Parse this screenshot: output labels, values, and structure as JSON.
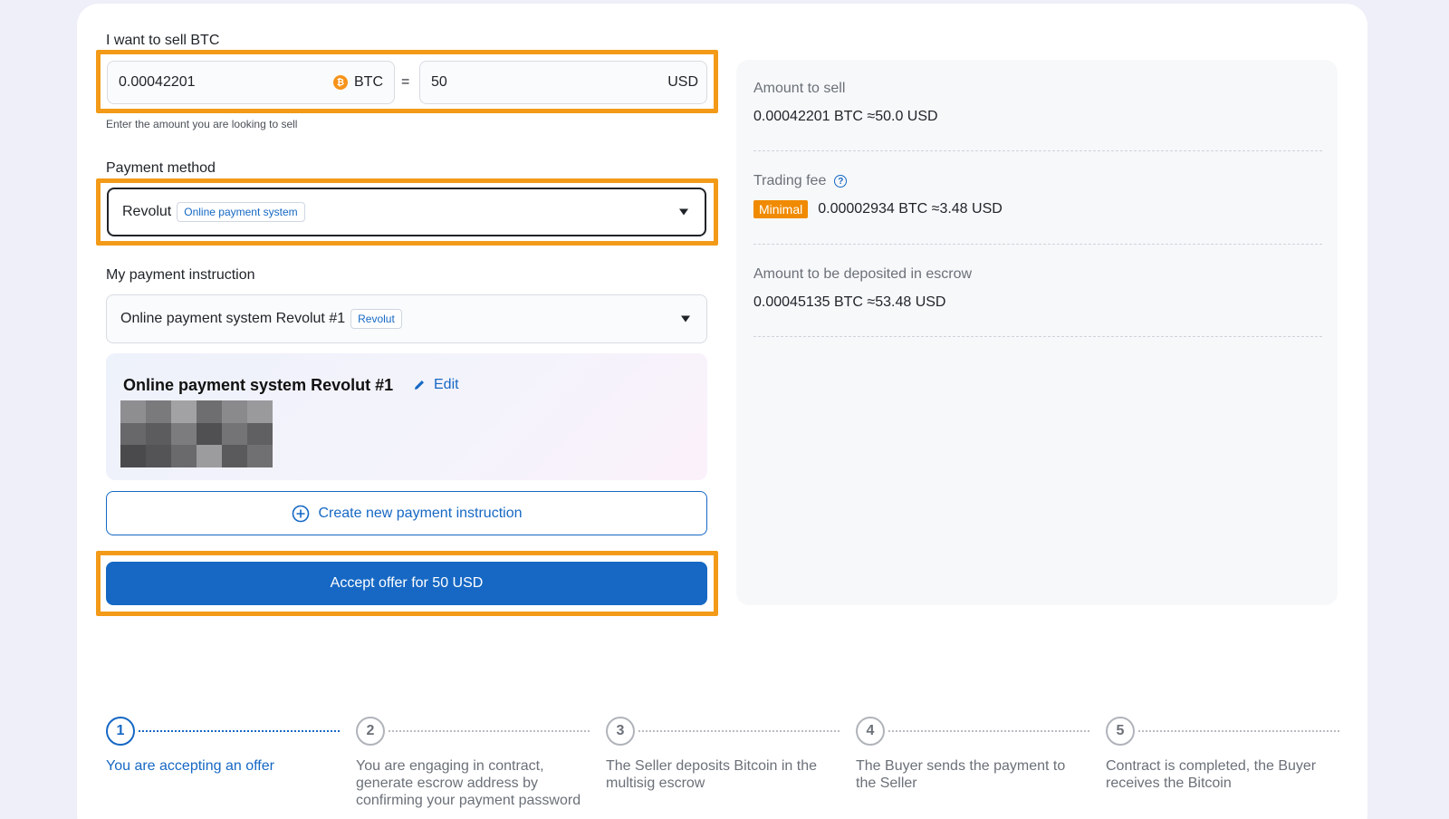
{
  "form": {
    "sell_label": "I want to sell BTC",
    "btc_amount": "0.00042201",
    "btc_currency": "BTC",
    "equals": "=",
    "usd_amount": "50",
    "usd_currency": "USD",
    "amount_hint": "Enter the amount you are looking to sell",
    "payment_method_label": "Payment method",
    "payment_method_value": "Revolut",
    "payment_method_tag": "Online payment system",
    "instruction_label": "My payment instruction",
    "instruction_value": "Online payment system Revolut #1",
    "instruction_tag": "Revolut",
    "instruction_card_title": "Online payment system Revolut #1",
    "edit_label": "Edit",
    "create_instruction_label": "Create new payment instruction",
    "accept_label": "Accept offer for 50 USD"
  },
  "summary": {
    "amount_to_sell_label": "Amount to sell",
    "amount_to_sell_value": "0.00042201 BTC ≈50.0 USD",
    "trading_fee_label": "Trading fee",
    "fee_badge": "Minimal",
    "trading_fee_value": "0.00002934 BTC ≈3.48 USD",
    "escrow_label": "Amount to be deposited in escrow",
    "escrow_value": "0.00045135 BTC ≈53.48 USD"
  },
  "steps": [
    {
      "number": "1",
      "text": "You are accepting an offer"
    },
    {
      "number": "2",
      "text": "You are engaging in contract, generate escrow address by confirming your payment password"
    },
    {
      "number": "3",
      "text": "The Seller deposits Bitcoin in the multisig escrow"
    },
    {
      "number": "4",
      "text": "The Buyer sends the payment to the Seller"
    },
    {
      "number": "5",
      "text": "Contract is completed, the Buyer receives the Bitcoin"
    }
  ],
  "colors": {
    "accent": "#1668c4",
    "highlight": "#f39a18",
    "badge": "#f08a00",
    "bitcoin": "#f7931a"
  }
}
